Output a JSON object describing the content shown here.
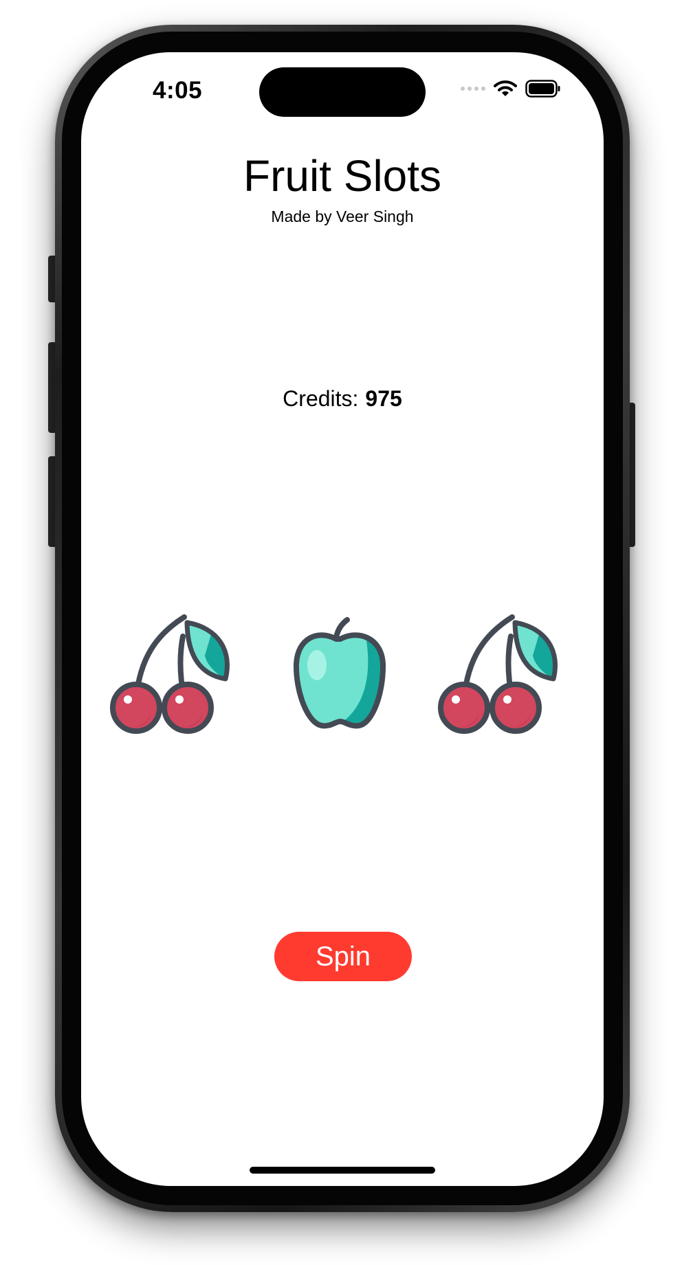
{
  "status_bar": {
    "time": "4:05",
    "icons": [
      "cellular-signal-icon",
      "wifi-icon",
      "battery-icon"
    ]
  },
  "header": {
    "title": "Fruit Slots",
    "subtitle": "Made by Veer Singh"
  },
  "credits": {
    "label": "Credits:",
    "value": "975"
  },
  "reels": [
    {
      "fruit": "cherry"
    },
    {
      "fruit": "apple"
    },
    {
      "fruit": "cherry"
    }
  ],
  "actions": {
    "spin_label": "Spin"
  },
  "colors": {
    "spin_button": "#ff3b30",
    "cherry_red": "#d2465e",
    "leaf_teal": "#6fe3cf",
    "leaf_teal_dark": "#14a69a",
    "outline": "#434a54"
  }
}
